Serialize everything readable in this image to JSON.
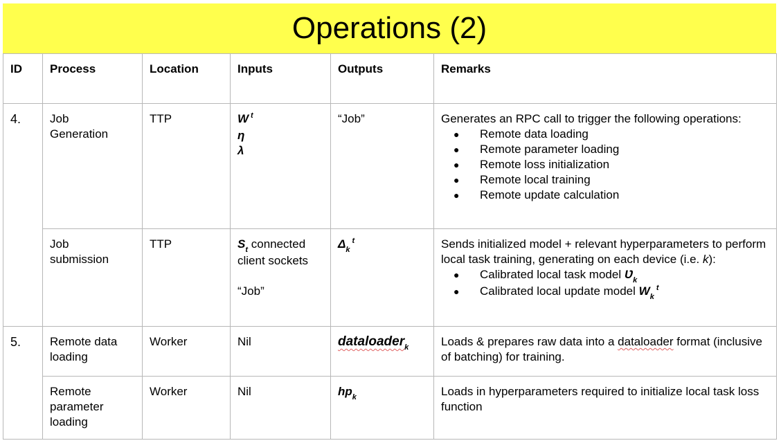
{
  "slide": {
    "title": "Operations (2)",
    "title_bg": "#ffff4d"
  },
  "table": {
    "headers": {
      "id": "ID",
      "process": "Process",
      "location": "Location",
      "inputs": "Inputs",
      "outputs": "Outputs",
      "remarks": "Remarks"
    },
    "rows": [
      {
        "id": "4.",
        "process": "Job\nGeneration",
        "location": "TTP",
        "inputs": {
          "w": "W",
          "w_sup": "t",
          "eta": "η",
          "lambda": "λ"
        },
        "outputs": "“Job”",
        "remarks": {
          "intro": "Generates an RPC call to trigger the following operations:",
          "bullets": [
            "Remote data loading",
            "Remote parameter loading",
            "Remote loss initialization",
            "Remote local training",
            "Remote update calculation"
          ]
        }
      },
      {
        "process": "Job\nsubmission",
        "location": "TTP",
        "inputs": {
          "s": "S",
          "s_sub": "t",
          "s_text": " connected client sockets",
          "job": "“Job”"
        },
        "outputs": {
          "delta": "Δ",
          "delta_sub": "k",
          "delta_sup": "t"
        },
        "remarks": {
          "intro_a": "Sends initialized model + relevant hyperparameters to perform local task training, generating on each device (i.e. ",
          "intro_k": "k",
          "intro_b": "):",
          "b1_text": "Calibrated local task model ",
          "b1_sym": "Ʋ",
          "b1_sub": "k",
          "b2_text": "Calibrated local update model ",
          "b2_sym": "W",
          "b2_sub": "k",
          "b2_sup": "t"
        }
      },
      {
        "id": "5.",
        "process": "Remote data\nloading",
        "location": "Worker",
        "inputs": "Nil",
        "outputs": {
          "sym": "dataloader",
          "sub": "k"
        },
        "remarks": {
          "a": "Loads & prepares raw data into a ",
          "b": "dataloader",
          "c": " format (inclusive of batching) for training."
        }
      },
      {
        "process": "Remote\nparameter\nloading",
        "location": "Worker",
        "inputs": "Nil",
        "outputs": {
          "sym": "hp",
          "sub": "k"
        },
        "remarks": "Loads in hyperparameters required to initialize local task loss function"
      }
    ]
  },
  "icons": {
    "bullet": "bullet-dot-icon"
  }
}
